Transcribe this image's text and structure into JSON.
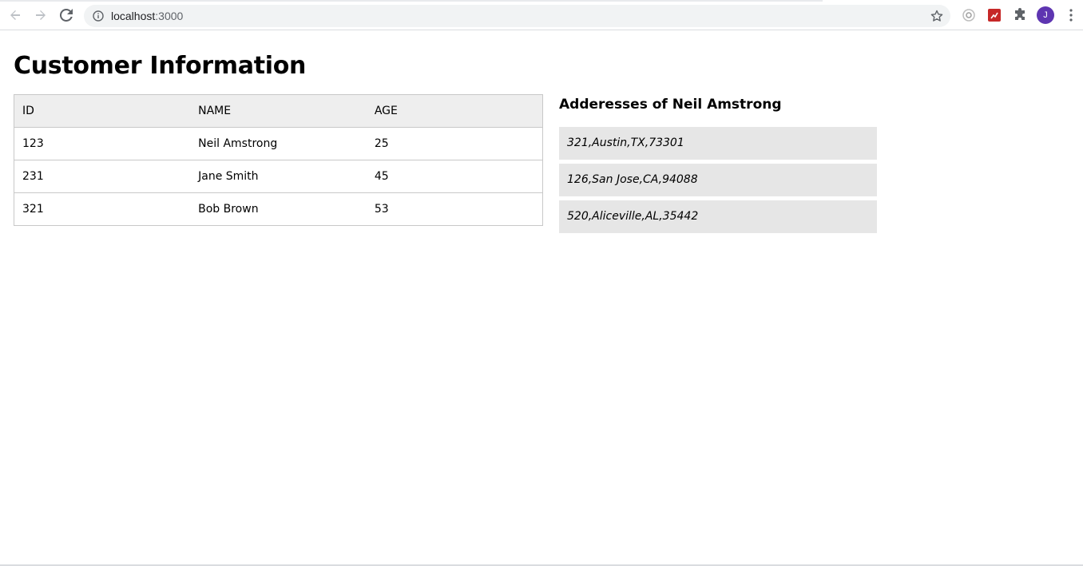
{
  "browser": {
    "url_host": "localhost",
    "url_port": ":3000",
    "avatar_letter": "J",
    "icons": [
      "back-arrow-icon",
      "forward-arrow-icon",
      "reload-icon",
      "info-icon",
      "star-icon",
      "extension-icon",
      "puzzle-icon",
      "more-vert-icon"
    ]
  },
  "page": {
    "title": "Customer Information",
    "table": {
      "headers": [
        "ID",
        "NAME",
        "AGE"
      ],
      "rows": [
        [
          "123",
          "Neil Amstrong",
          "25"
        ],
        [
          "231",
          "Jane Smith",
          "45"
        ],
        [
          "321",
          "Bob Brown",
          "53"
        ]
      ]
    },
    "addresses": {
      "title": "Adderesses of Neil Amstrong",
      "items": [
        "321,Austin,TX,73301",
        "126,San Jose,CA,94088",
        "520,Aliceville,AL,35442"
      ]
    }
  },
  "colors": {
    "header_bg": "#eeeeee",
    "address_bg": "#e6e6e6",
    "border": "#c8c8c8",
    "avatar": "#5e35b1"
  }
}
